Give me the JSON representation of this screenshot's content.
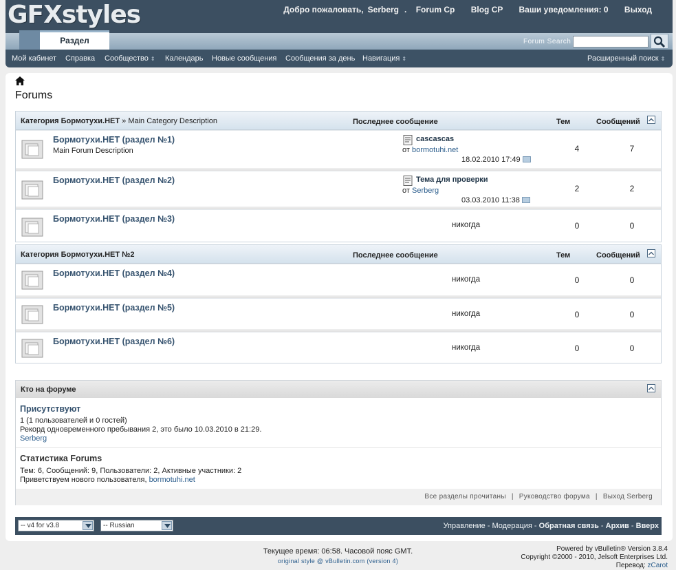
{
  "header": {
    "logo": "GFXstyles",
    "welcome": "Добро пожаловать,",
    "username": "Serberg",
    "dot": ".",
    "links": [
      "Forum Cp",
      "Blog CP",
      "Ваши уведомления: 0",
      "Выход"
    ]
  },
  "tabs": {
    "active": "Раздел",
    "search_label": "Forum Search",
    "search_placeholder": ""
  },
  "nav": {
    "items": [
      "Мой кабинет",
      "Справка",
      "Сообщество",
      "Календарь",
      "Новые сообщения",
      "Сообщения за день",
      "Навигация"
    ],
    "dropdown_arrow": "⇕",
    "advanced_search": "Расширенный поиск"
  },
  "page": {
    "title": "Forums"
  },
  "columns": {
    "last_post": "Последнее сообщение",
    "threads": "Тем",
    "posts": "Сообщений"
  },
  "categories": [
    {
      "title": "Категория Бормотухи.НЕТ",
      "sep": "»",
      "description": "Main Category Description",
      "forums": [
        {
          "title": "Бормотухи.НЕТ (раздел №1)",
          "description": "Main Forum Description",
          "last_title": "cascascas",
          "by_prefix": "от",
          "last_user": "bormotuhi.net",
          "last_date": "18.02.2010 17:49",
          "threads": "4",
          "posts": "7"
        },
        {
          "title": "Бормотухи.НЕТ (раздел №2)",
          "description": "",
          "last_title": "Тема для проверки",
          "by_prefix": "от",
          "last_user": "Serberg",
          "last_date": "03.03.2010 11:38",
          "threads": "2",
          "posts": "2"
        },
        {
          "title": "Бормотухи.НЕТ (раздел №3)",
          "never": "никогда",
          "threads": "0",
          "posts": "0"
        }
      ]
    },
    {
      "title": "Категория Бормотухи.НЕТ №2",
      "forums": [
        {
          "title": "Бормотухи.НЕТ (раздел №4)",
          "never": "никогда",
          "threads": "0",
          "posts": "0"
        },
        {
          "title": "Бормотухи.НЕТ (раздел №5)",
          "never": "никогда",
          "threads": "0",
          "posts": "0"
        },
        {
          "title": "Бормотухи.НЕТ (раздел №6)",
          "never": "никогда",
          "threads": "0",
          "posts": "0"
        }
      ]
    }
  ],
  "online": {
    "title": "Кто на форуме",
    "present_title": "Присутствуют",
    "count_line": "1 (1 пользователей и 0 гостей)",
    "record_line": "Рекорд одновременного пребывания 2, это было 10.03.2010 в 21:29.",
    "user": "Serberg",
    "stats_title": "Статистика Forums",
    "stats_line": "Тем: 6, Сообщений: 9, Пользователи: 2, Активные участники: 2",
    "welcome_line": "Приветствуем нового пользователя,",
    "new_user": "bormotuhi.net",
    "footer_links": [
      "Все разделы прочитаны",
      "Руководство форума",
      "Выход Serberg"
    ],
    "footer_sep": "|"
  },
  "footer": {
    "style_select": "-- v4 for v3.8",
    "lang_select": "-- Russian",
    "links": [
      "Управление",
      "Модерация",
      "Обратная связь",
      "Архив",
      "Вверх"
    ],
    "link_sep": "-",
    "time_text": "Текущее время: 06:58. Часовой пояс GMT.",
    "original_style": "original style @ vBulletin.com (version 4)",
    "powered": "Powered by vBulletin® Version 3.8.4",
    "copyright": "Copyright ©2000 - 2010, Jelsoft Enterprises Ltd.",
    "translation_prefix": "Перевод:",
    "translation_by": "zCarot"
  }
}
